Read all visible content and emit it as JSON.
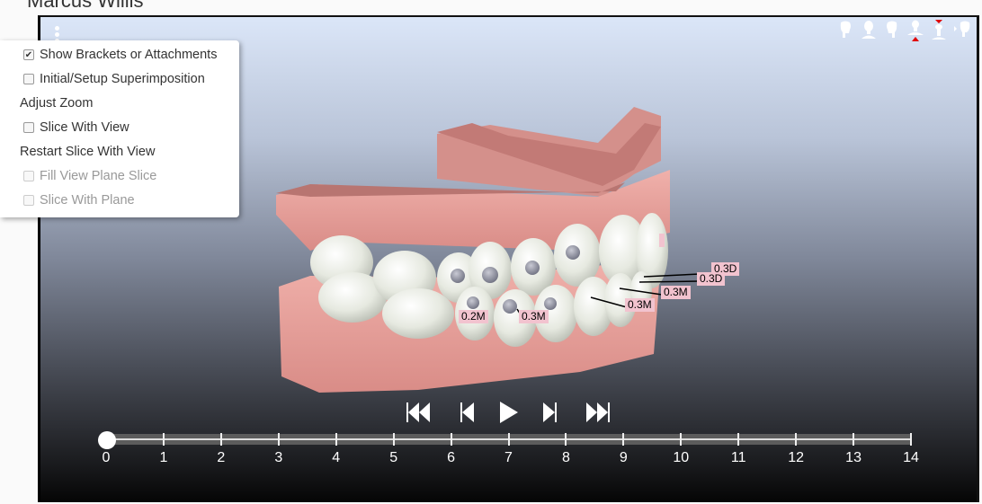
{
  "header": {
    "patient_name": "Marcus Willis"
  },
  "viewer": {
    "view_icons": [
      {
        "name": "right-view-icon",
        "label": "Right"
      },
      {
        "name": "front-view-icon",
        "label": "Front"
      },
      {
        "name": "left-view-icon",
        "label": "Left"
      },
      {
        "name": "upper-jaw-view-icon",
        "label": "Upper Jaw",
        "indicator": "#e00000"
      },
      {
        "name": "lower-jaw-view-icon",
        "label": "Lower Jaw",
        "indicator": "#e00000"
      },
      {
        "name": "back-view-icon",
        "label": "Back"
      }
    ],
    "measurements": [
      {
        "label": "0.3D"
      },
      {
        "label": "0.3D"
      },
      {
        "label": "0.3M"
      },
      {
        "label": "0.3M"
      },
      {
        "label": "0.2M"
      },
      {
        "label": "0.3M"
      }
    ],
    "colors": {
      "gum": "#e9a19c",
      "tooth": "#e8ebe3",
      "attachment": "#8e909e",
      "label_bg": "#f2c3cf"
    }
  },
  "playback": {
    "buttons": [
      "first-stage",
      "previous-stage",
      "play",
      "next-stage",
      "last-stage"
    ],
    "current_stage": 0,
    "min_stage": 0,
    "max_stage": 14,
    "ticks": [
      "0",
      "1",
      "2",
      "3",
      "4",
      "5",
      "6",
      "7",
      "8",
      "9",
      "10",
      "11",
      "12",
      "13",
      "14"
    ]
  },
  "options_menu": {
    "items": [
      {
        "type": "checkbox",
        "label": "Show Brackets or Attachments",
        "checked": true,
        "disabled": false
      },
      {
        "type": "checkbox",
        "label": "Initial/Setup Superimposition",
        "checked": false,
        "disabled": false
      },
      {
        "type": "action",
        "label": "Adjust Zoom"
      },
      {
        "type": "checkbox",
        "label": "Slice With View",
        "checked": false,
        "disabled": false
      },
      {
        "type": "action",
        "label": "Restart Slice With View"
      },
      {
        "type": "checkbox",
        "label": "Fill View Plane Slice",
        "checked": false,
        "disabled": true
      },
      {
        "type": "checkbox",
        "label": "Slice With Plane",
        "checked": false,
        "disabled": true
      }
    ]
  }
}
